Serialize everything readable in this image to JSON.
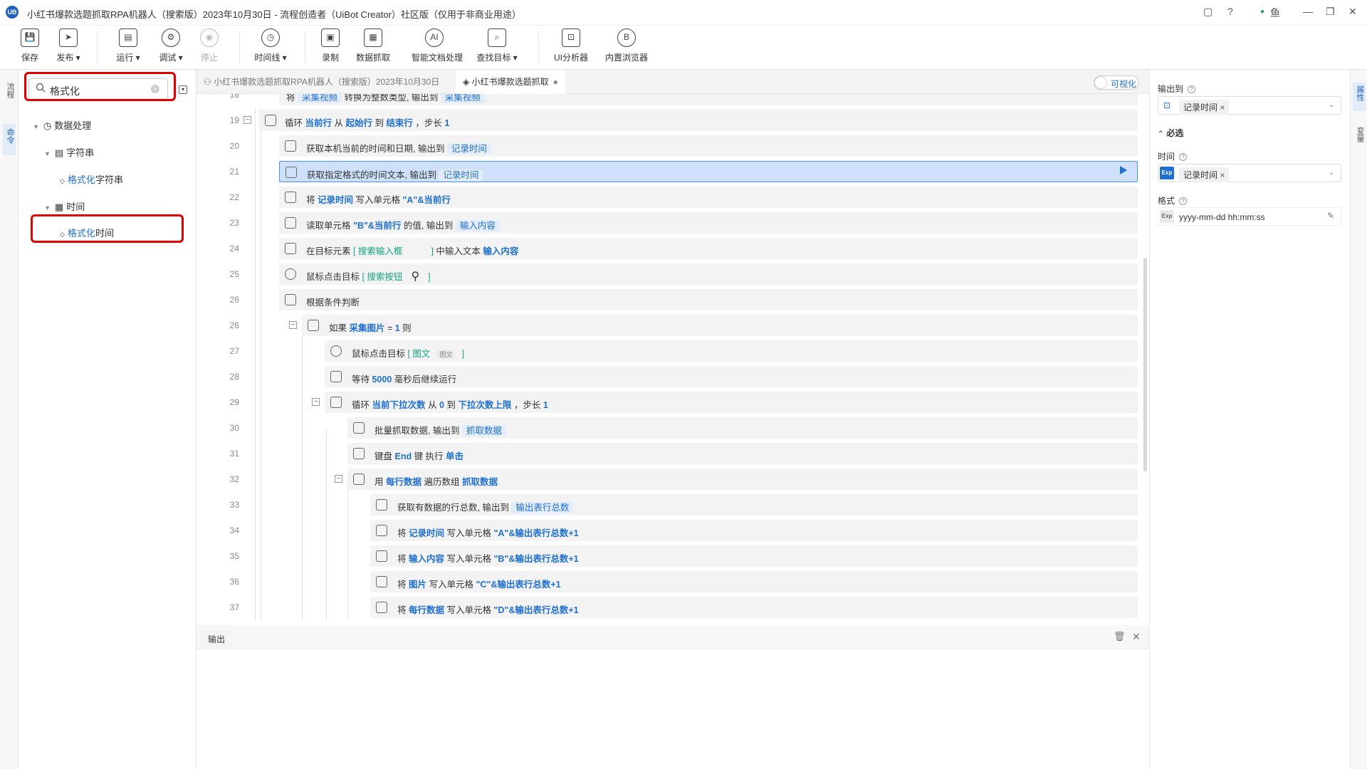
{
  "window": {
    "logo": "UB",
    "title": "小红书爆款选题抓取RPA机器人（搜索版）2023年10月30日 - 流程创造者（UiBot Creator）社区版（仅用于非商业用途）",
    "user": "鱼",
    "controls": [
      "▢",
      "?",
      "●",
      "—",
      "❐",
      "✕"
    ]
  },
  "toolbar": [
    {
      "label": "保存",
      "icon": "💾"
    },
    {
      "label": "发布 ▾",
      "icon": "➤"
    },
    {
      "label": "运行 ▾",
      "icon": "▤"
    },
    {
      "label": "调试 ▾",
      "icon": "⚙"
    },
    {
      "label": "停止",
      "icon": "◉",
      "disabled": true
    },
    {
      "label": "时间线 ▾",
      "icon": "◷"
    },
    {
      "label": "录制",
      "icon": "▣"
    },
    {
      "label": "数据抓取",
      "icon": "▦"
    },
    {
      "label": "智能文档处理",
      "icon": "AI"
    },
    {
      "label": "查找目标 ▾",
      "icon": "⌕"
    },
    {
      "label": "UI分析器",
      "icon": "⊡"
    },
    {
      "label": "内置浏览器",
      "icon": "B"
    }
  ],
  "left_strip": {
    "tab1": "流程",
    "tab2": "命令"
  },
  "search": {
    "value": "格式化",
    "clear": "×"
  },
  "tree": {
    "category": "数据处理",
    "group1": "字符串",
    "item1_hl": "格式化",
    "item1_rest": "字符串",
    "group2": "时间",
    "item2_hl": "格式化",
    "item2_rest": "时间"
  },
  "tabs": {
    "tab1": "小红书爆款选题抓取RPA机器人（搜索版）2023年10月30日",
    "tab2": "小红书爆款选题抓取",
    "toggle_label": "可视化"
  },
  "code": {
    "r18_no": "18",
    "r18_a": "将 ",
    "r18_b": "采集视频",
    "r18_c": " 转换为整数类型, 输出到 ",
    "r18_d": "采集视频",
    "r19_no": "19",
    "r19_a": "循环 ",
    "r19_b": "当前行",
    "r19_c": " 从 ",
    "r19_d": "起始行",
    "r19_e": " 到 ",
    "r19_f": "结束行",
    "r19_g": " ，步长 ",
    "r19_h": "1",
    "r20_no": "20",
    "r20_a": "获取本机当前的时间和日期, 输出到 ",
    "r20_b": "记录时间",
    "r21_no": "21",
    "r21_a": "获取指定格式的时间文本, 输出到 ",
    "r21_b": "记录时间",
    "r22_no": "22",
    "r22_a": "将 ",
    "r22_b": "记录时间",
    "r22_c": " 写入单元格 ",
    "r22_d": "\"A\"&当前行",
    "r23_no": "23",
    "r23_a": "读取单元格 ",
    "r23_b": "\"B\"&当前行",
    "r23_c": " 的值, 输出到 ",
    "r23_d": "输入内容",
    "r24_no": "24",
    "r24_a": "在目标元素 ",
    "r24_b": "[ 搜索输入框",
    "r24_c": "]",
    "r24_d": " 中输入文本 ",
    "r24_e": "输入内容",
    "r25_no": "25",
    "r25_a": "鼠标点击目标 ",
    "r25_b": "[ 搜索按钮",
    "r25_c": "]",
    "r26a_no": "26",
    "r26a_a": "根据条件判断",
    "r26b_no": "26",
    "r26b_a": "如果 ",
    "r26b_b": "采集图片",
    "r26b_c": " = ",
    "r26b_d": "1",
    "r26b_e": " 则",
    "r27_no": "27",
    "r27_a": "鼠标点击目标 ",
    "r27_b": "[ 图文",
    "r27_c": "图文",
    "r27_d": "]",
    "r28_no": "28",
    "r28_a": "等待 ",
    "r28_b": "5000",
    "r28_c": " 毫秒后继续运行",
    "r29_no": "29",
    "r29_a": "循环 ",
    "r29_b": "当前下拉次数",
    "r29_c": " 从 ",
    "r29_d": "0",
    "r29_e": " 到 ",
    "r29_f": "下拉次数上限",
    "r29_g": " ，步长 ",
    "r29_h": "1",
    "r30_no": "30",
    "r30_a": "批量抓取数据, 输出到 ",
    "r30_b": "抓取数据",
    "r31_no": "31",
    "r31_a": "键盘 ",
    "r31_b": "End",
    "r31_c": " 键 执行 ",
    "r31_d": "单击",
    "r32_no": "32",
    "r32_a": "用 ",
    "r32_b": "每行数据",
    "r32_c": " 遍历数组 ",
    "r32_d": "抓取数据",
    "r33_no": "33",
    "r33_a": "获取有数据的行总数, 输出到 ",
    "r33_b": "输出表行总数",
    "r34_no": "34",
    "r34_a": "将 ",
    "r34_b": "记录时间",
    "r34_c": " 写入单元格 ",
    "r34_d": "\"A\"&输出表行总数+1",
    "r35_no": "35",
    "r35_a": "将 ",
    "r35_b": "输入内容",
    "r35_c": " 写入单元格 ",
    "r35_d": "\"B\"&输出表行总数+1",
    "r36_no": "36",
    "r36_a": "将 ",
    "r36_b": "图片",
    "r36_c": " 写入单元格 ",
    "r36_d": "\"C\"&输出表行总数+1",
    "r37_no": "37",
    "r37_a": "将 ",
    "r37_b": "每行数据",
    "r37_c": " 写入单元格 ",
    "r37_d": "\"D\"&输出表行总数+1"
  },
  "output": {
    "tab": "输出",
    "trash": "🗑",
    "close": "✕"
  },
  "props": {
    "output_label": "输出到",
    "output_value": "记录时间",
    "required": "必选",
    "time_label": "时间",
    "time_value": "记录时间",
    "format_label": "格式",
    "format_value": "yyyy-mm-dd hh:mm:ss",
    "exp": "Exp"
  },
  "right_strip": {
    "tab1": "属性",
    "tab2": "变量"
  },
  "colors": {
    "accent": "#1f6fd1",
    "highlight_border": "#e00000",
    "selected_row": "#cfe0fb"
  }
}
